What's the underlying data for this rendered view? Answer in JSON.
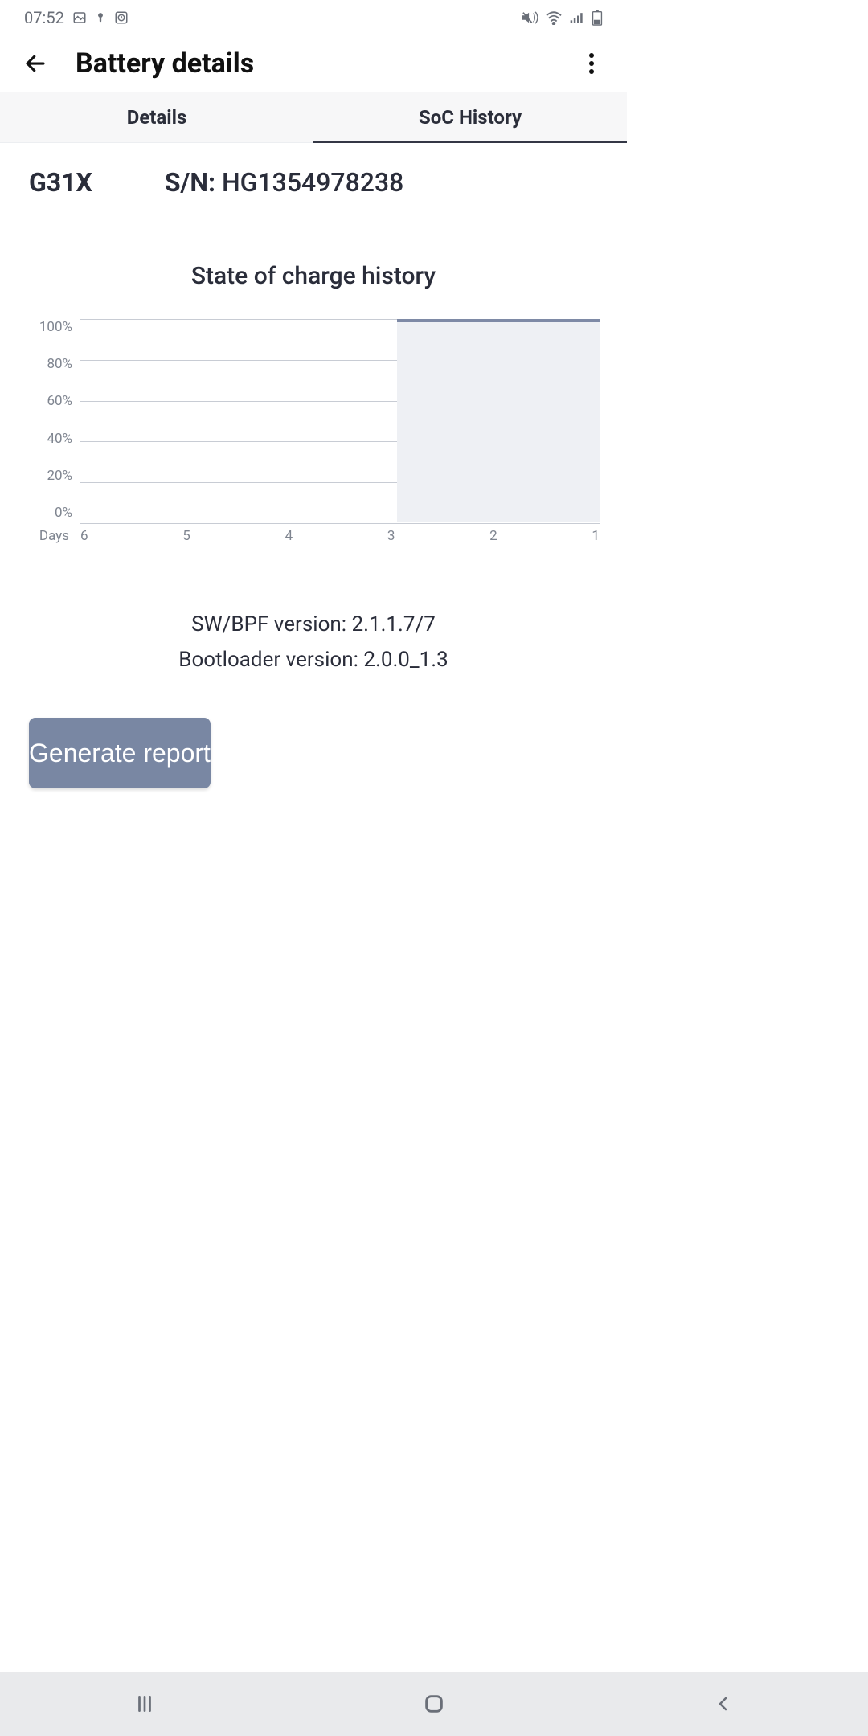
{
  "status": {
    "time": "07:52"
  },
  "appbar": {
    "title": "Battery details"
  },
  "tabs": {
    "details": "Details",
    "soc": "SoC History"
  },
  "device": {
    "model": "G31X",
    "serial_label": "S/N:",
    "serial_value": "HG1354978238"
  },
  "chart_data": {
    "type": "area",
    "title": "State of charge history",
    "xlabel": "Days",
    "ylabel": "",
    "ylim": [
      0,
      100
    ],
    "x_ticks": [
      "6",
      "5",
      "4",
      "3",
      "2",
      "1"
    ],
    "y_ticks": [
      "100%",
      "80%",
      "60%",
      "40%",
      "20%",
      "0%"
    ],
    "x": [
      6,
      5,
      4,
      3,
      2,
      1
    ],
    "values": [
      null,
      null,
      null,
      100,
      100,
      100
    ]
  },
  "versions": {
    "sw_label": "SW/BPF version:",
    "sw_value": "2.1.1.7/7",
    "boot_label": "Bootloader version:",
    "boot_value": "2.0.0_1.3"
  },
  "button": {
    "generate": "Generate report"
  }
}
